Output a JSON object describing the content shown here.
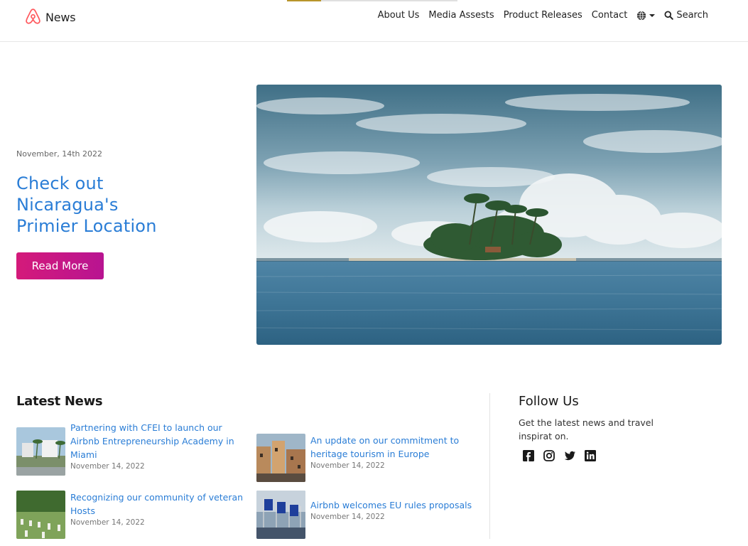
{
  "header": {
    "logo_text": "News",
    "nav": {
      "about": "About Us",
      "media": "Media Assests",
      "product": "Product Releases",
      "contact": "Contact",
      "search": "Search"
    },
    "icons": [
      "airbnb-logo-icon",
      "globe-icon",
      "chevron-down-icon",
      "search-icon"
    ]
  },
  "hero": {
    "date": "November, 14th 2022",
    "title_line1": "Check out",
    "title_line2": "Nicaragua's",
    "title_line3": "Primier Location",
    "cta_label": "Read More"
  },
  "latest": {
    "heading": "Latest News",
    "items": [
      {
        "title": "Partnering with CFEI to launch our Airbnb Entrepreneurship Academy in Miami",
        "date": "November 14, 2022"
      },
      {
        "title": "An update on our commitment to heritage tourism in Europe",
        "date": "November 14, 2022"
      },
      {
        "title": "Recognizing our community of veteran Hosts",
        "date": "November 14, 2022"
      },
      {
        "title": "Airbnb welcomes EU rules proposals",
        "date": "November 14, 2022"
      }
    ]
  },
  "follow": {
    "heading": "Follow Us",
    "text": "Get the latest news and travel inspirat on.",
    "icons": [
      "facebook-icon",
      "instagram-icon",
      "twitter-icon",
      "linkedin-icon"
    ]
  },
  "colors": {
    "accent_blue": "#2a7dd6",
    "cta_gradient_start": "#d41a7a",
    "cta_gradient_end": "#b81491",
    "brand": "#ff5a5f"
  }
}
